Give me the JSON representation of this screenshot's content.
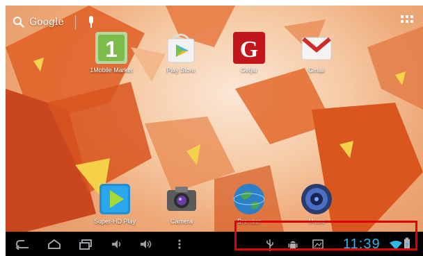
{
  "search": {
    "label": "Google"
  },
  "apps": {
    "top": [
      {
        "label": "1Mobile Market",
        "icon": "1mobile-market-icon"
      },
      {
        "label": "Play Store",
        "icon": "play-store-icon"
      },
      {
        "label": "Getjar",
        "icon": "getjar-icon"
      },
      {
        "label": "Gmail",
        "icon": "gmail-icon"
      }
    ],
    "bottom": [
      {
        "label": "Super-HD Play",
        "icon": "video-play-icon"
      },
      {
        "label": "Camera",
        "icon": "camera-icon"
      },
      {
        "label": "Browser",
        "icon": "globe-icon"
      },
      {
        "label": "Music",
        "icon": "speaker-icon"
      }
    ]
  },
  "status": {
    "time": "11:39"
  },
  "colors": {
    "clock": "#2fb7e8",
    "highlight": "#e10000",
    "navbar": "#000000"
  }
}
